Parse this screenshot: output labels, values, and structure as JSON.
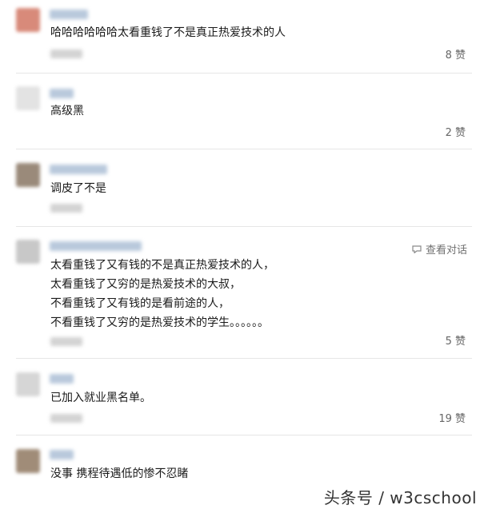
{
  "comments": [
    {
      "text": "哈哈哈哈哈哈太看重钱了不是真正热爱技术的人",
      "likes": "8 赞"
    },
    {
      "text": "高级黑",
      "likes": "2 赞"
    },
    {
      "text": "调皮了不是",
      "likes": ""
    },
    {
      "lines": [
        "太看重钱了又有钱的不是真正热爱技术的人，",
        "太看重钱了又穷的是热爱技术的大叔，",
        "不看重钱了又有钱的是看前途的人，",
        "不看重钱了又穷的是热爱技术的学生。。。。。。"
      ],
      "likes": "5 赞",
      "view_dialog": "查看对话"
    },
    {
      "text": "已加入就业黑名单。",
      "likes": "19 赞"
    },
    {
      "text": "没事 携程待遇低的惨不忍睹",
      "likes": ""
    }
  ],
  "watermark": "头条号 / w3cschool",
  "colors": {
    "avatar_1": "#d88a7a",
    "avatar_2": "#e3e3e3",
    "avatar_3": "#9a8a7a",
    "avatar_4": "#c8c8c8",
    "avatar_5": "#d6d6d6",
    "avatar_6": "#a08c78"
  }
}
